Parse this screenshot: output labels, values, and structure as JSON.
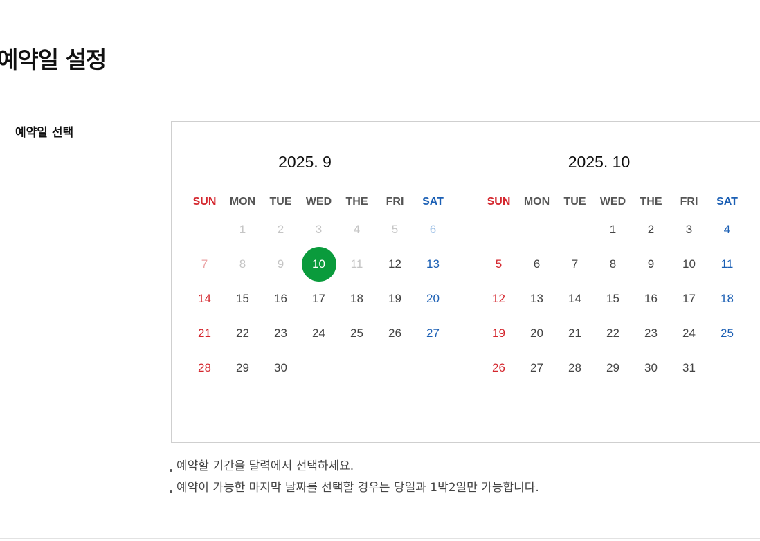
{
  "page": {
    "title": "예약일 설정"
  },
  "form": {
    "label": "예약일 선택"
  },
  "weekdays": [
    "SUN",
    "MON",
    "TUE",
    "WED",
    "THE",
    "FRI",
    "SAT"
  ],
  "months": [
    {
      "title": "2025. 9",
      "first_weekday": 1,
      "days": 30,
      "past_until": 11,
      "selected": 10
    },
    {
      "title": "2025. 10",
      "first_weekday": 3,
      "days": 31,
      "past_until": 0,
      "selected": null
    }
  ],
  "notes": [
    "예약할 기간을 달력에서 선택하세요.",
    "예약이 가능한 마지막 날짜를 선택할 경우는 당일과 1박2일만 가능합니다."
  ],
  "colors": {
    "sunday": "#d4262d",
    "saturday": "#1b5fb4",
    "selected": "#0a9b3c"
  }
}
